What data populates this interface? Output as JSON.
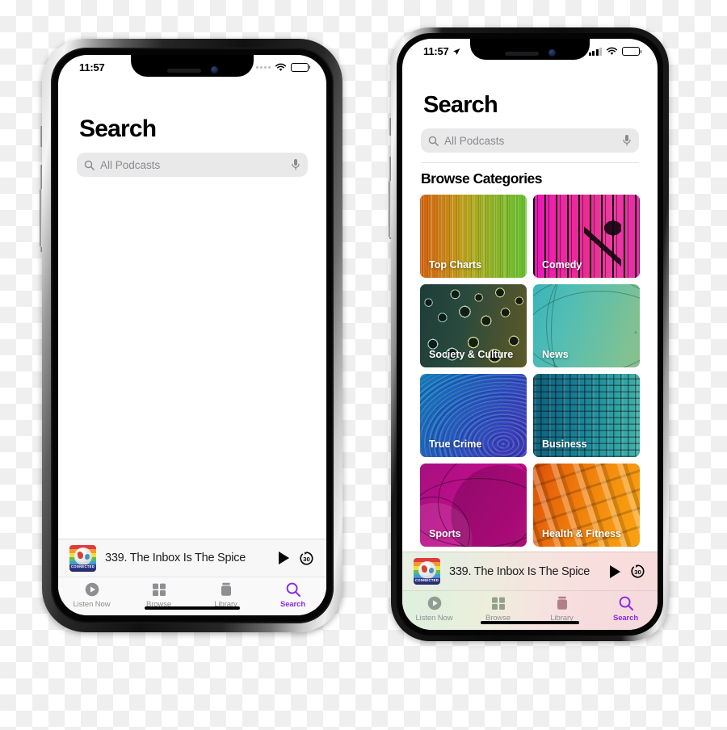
{
  "phones": {
    "left": {
      "device_name": "iphone-x-silver",
      "status_bar": {
        "time": "11:57",
        "signal_icon": "cellular-dots-icon",
        "wifi_icon": "wifi-icon",
        "battery_icon": "battery-icon"
      },
      "page_title": "Search",
      "search": {
        "icon": "search-icon",
        "placeholder": "All Podcasts",
        "value": "",
        "mic_icon": "microphone-icon"
      },
      "now_playing": {
        "artwork_name": "connected-podcast-artwork",
        "artwork_badge": "CONNECTED",
        "title": "339. The Inbox Is The Spice",
        "play_icon": "play-icon",
        "skip_icon": "skip-forward-30-icon",
        "skip_label": "30"
      },
      "tabs": [
        {
          "label": "Listen Now",
          "icon": "play-circle-icon",
          "active": false
        },
        {
          "label": "Browse",
          "icon": "grid-squares-icon",
          "active": false
        },
        {
          "label": "Library",
          "icon": "library-box-icon",
          "active": false
        },
        {
          "label": "Search",
          "icon": "magnifier-icon",
          "active": true
        }
      ]
    },
    "right": {
      "device_name": "iphone-12-silver",
      "status_bar": {
        "time": "11:57",
        "location_icon": "location-arrow-icon",
        "signal_icon": "cellular-bars-icon",
        "wifi_icon": "wifi-icon",
        "battery_icon": "battery-icon"
      },
      "page_title": "Search",
      "search": {
        "icon": "search-icon",
        "placeholder": "All Podcasts",
        "value": "",
        "mic_icon": "microphone-icon"
      },
      "browse": {
        "section_title": "Browse Categories",
        "categories": [
          {
            "label": "Top Charts",
            "art": "art-topcharts"
          },
          {
            "label": "Comedy",
            "art": "art-comedy"
          },
          {
            "label": "Society & Culture",
            "art": "art-society"
          },
          {
            "label": "News",
            "art": "art-news"
          },
          {
            "label": "True Crime",
            "art": "art-truecrime"
          },
          {
            "label": "Business",
            "art": "art-business"
          },
          {
            "label": "Sports",
            "art": "art-sports"
          },
          {
            "label": "Health & Fitness",
            "art": "art-health"
          }
        ]
      },
      "now_playing": {
        "artwork_name": "connected-podcast-artwork",
        "artwork_badge": "CONNECTED",
        "title": "339. The Inbox Is The Spice",
        "play_icon": "play-icon",
        "skip_icon": "skip-forward-30-icon",
        "skip_label": "30"
      },
      "tabs": [
        {
          "label": "Listen Now",
          "icon": "play-circle-icon",
          "active": false
        },
        {
          "label": "Browse",
          "icon": "grid-squares-icon",
          "active": false
        },
        {
          "label": "Library",
          "icon": "library-box-icon",
          "active": false
        },
        {
          "label": "Search",
          "icon": "magnifier-icon",
          "active": true
        }
      ]
    }
  },
  "colors": {
    "accent": "#8a2be2",
    "tab_inactive": "#8e8e93",
    "search_field_bg": "#e9e9ea",
    "placeholder": "#8a8a8e"
  }
}
